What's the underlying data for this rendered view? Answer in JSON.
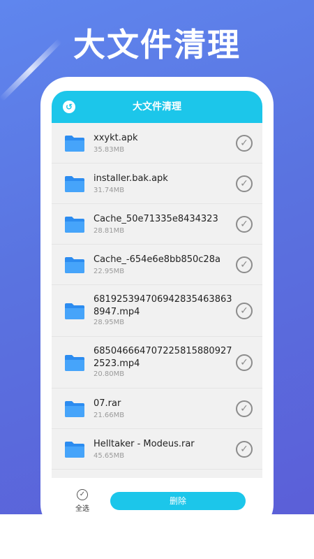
{
  "banner": {
    "headline": "大文件清理"
  },
  "header": {
    "title": "大文件清理",
    "back_icon": "back-icon"
  },
  "files": [
    {
      "name": "xxykt.apk",
      "size": "35.83MB"
    },
    {
      "name": "installer.bak.apk",
      "size": "31.74MB"
    },
    {
      "name": "Cache_50e71335e8434323",
      "size": "28.81MB"
    },
    {
      "name": "Cache_-654e6e8bb850c28a",
      "size": "22.95MB"
    },
    {
      "name": "681925394706942835463863 8947.mp4",
      "size": "28.95MB"
    },
    {
      "name": "685046664707225815880927 2523.mp4",
      "size": "20.80MB"
    },
    {
      "name": "07.rar",
      "size": "21.66MB"
    },
    {
      "name": "Helltaker - Modeus.rar",
      "size": "45.65MB"
    }
  ],
  "footer": {
    "select_all": "全选",
    "delete": "删除"
  },
  "colors": {
    "accent": "#1cc6ea",
    "folder": "#2c8cf0",
    "background": "#5a73e0"
  }
}
